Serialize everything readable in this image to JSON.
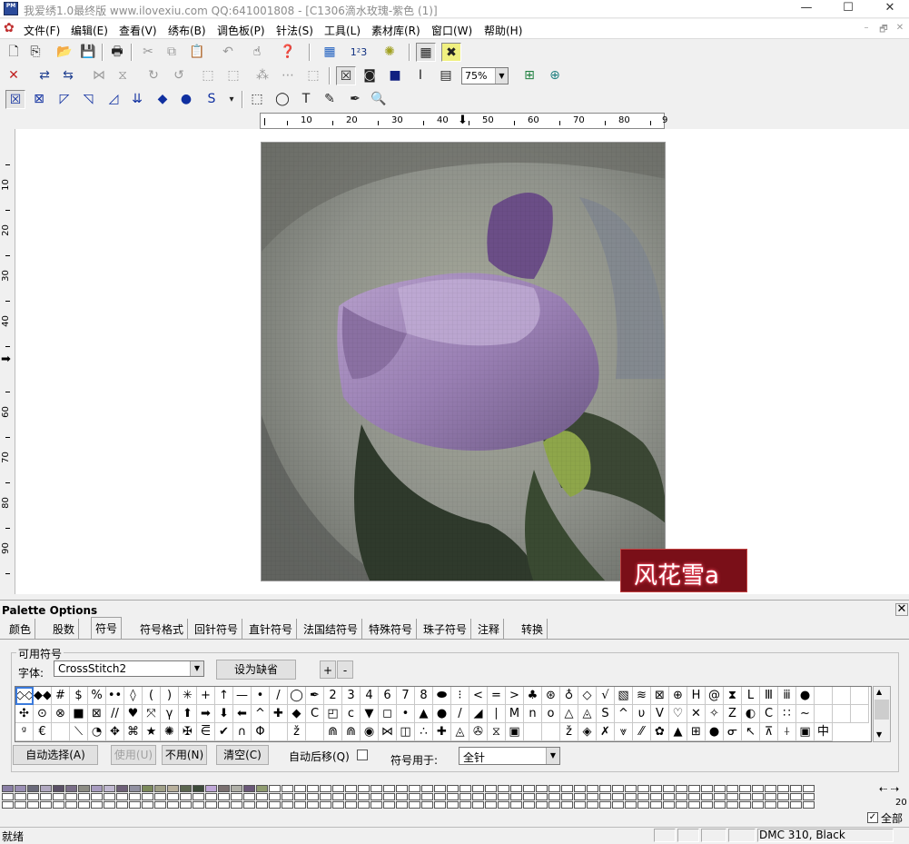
{
  "window": {
    "title": "我爱绣1.0最终版 www.ilovexiu.com QQ:641001808 - [C1306滴水玫瑰-紫色 (1)]",
    "app_icon_text": "PM",
    "minimize": "—",
    "maximize": "☐",
    "close": "✕"
  },
  "menu": {
    "items": [
      "文件(F)",
      "编辑(E)",
      "查看(V)",
      "绣布(B)",
      "调色板(P)",
      "针法(S)",
      "工具(L)",
      "素材库(R)",
      "窗口(W)",
      "帮助(H)"
    ],
    "mdi": [
      "–",
      "🗗",
      "✕"
    ]
  },
  "toolbar1": {
    "icons": [
      "new-icon",
      "copy-file-icon",
      "open-icon",
      "save-icon",
      "print-icon",
      "cut-icon",
      "copy-icon",
      "paste-icon",
      "undo-icon",
      "pointer-icon",
      "help-icon",
      "palette-icon",
      "number-icon",
      "sun-icon",
      "grid-icon",
      "cross-tool-icon"
    ],
    "glyphs": [
      "🗋",
      "⎘",
      "📂",
      "💾",
      "🖶",
      "✂",
      "⧉",
      "📋",
      "↶",
      "☝",
      "❓",
      "▦",
      "1²3",
      "✺",
      "▦",
      "✖"
    ]
  },
  "toolbar2": {
    "glyphs": [
      "✕",
      "⇄",
      "⇆",
      "⋈",
      "⧖",
      "↻",
      "↺",
      "⬚",
      "⬚",
      "⁂",
      "⋯",
      "⬚",
      "☒",
      "◙",
      "■",
      "I",
      "▤",
      "⊞",
      "⊕"
    ],
    "zoom": "75%"
  },
  "toolbar3": {
    "glyphs": [
      "☒",
      "⊠",
      "◸",
      "◹",
      "◿",
      "⇊",
      "◆",
      "●",
      "S",
      "▾",
      "⬚",
      "◯",
      "T",
      "✎",
      "✒",
      "🔍"
    ]
  },
  "ruler": {
    "h_labels": [
      "10",
      "20",
      "30",
      "40",
      "50",
      "60",
      "70",
      "80",
      "9"
    ],
    "v_labels": [
      "10",
      "20",
      "30",
      "40",
      "50",
      "60",
      "70",
      "80",
      "90"
    ]
  },
  "watermark": {
    "text": "风花雪a"
  },
  "palette": {
    "title": "Palette Options",
    "close": "✕",
    "tabs": [
      "颜色",
      "股数",
      "符号",
      "符号格式",
      "回针符号",
      "直针符号",
      "法国结符号",
      "特殊符号",
      "珠子符号",
      "注释",
      "转换"
    ],
    "active_tab": "符号",
    "group_label": "可用符号",
    "font_label": "字体:",
    "font_value": "CrossStitch2",
    "set_default": "设为缺省",
    "plus": "+",
    "minus": "-",
    "symbols": [
      "◇◇",
      "◆◆",
      "#",
      "$",
      "%",
      "••",
      "◊",
      "(",
      ")",
      "✳",
      "+",
      "↑",
      "—",
      "•",
      "/",
      "◯",
      "✒",
      "2",
      "3",
      "4",
      "6",
      "7",
      "8",
      "⬬",
      "⁝",
      "<",
      "=",
      ">",
      "♣",
      "⊛",
      "♁",
      "◇",
      "√",
      "▧",
      "≋",
      "⊠",
      "⊕",
      "H",
      "@",
      "⧗",
      "L",
      "Ⅲ",
      "ⅲ",
      "●",
      "",
      "",
      "",
      "✣",
      "⊙",
      "⊗",
      "■",
      "⊠",
      "//",
      "♥",
      "⤧",
      "γ",
      "⬆",
      "➡",
      "⬇",
      "⬅",
      "^",
      "✚",
      "◆",
      "C",
      "◰",
      "c",
      "▼",
      "◻",
      "•",
      "▲",
      "●",
      "/",
      "◢",
      "∣",
      "M",
      "n",
      "o",
      "△",
      "◬",
      "Ѕ",
      "^",
      "υ",
      "V",
      "♡",
      "✕",
      "✧",
      "Z",
      "◐",
      "C",
      "∷",
      "~",
      "",
      "",
      "",
      "ᵍ",
      "€",
      "",
      "⟍",
      "◔",
      "✥",
      "⌘",
      "★",
      "✺",
      "✠",
      "⋶",
      "✔",
      "∩",
      "Φ",
      "",
      "ž",
      "",
      "⋒",
      "⋒",
      "◉",
      "⋈",
      "◫",
      "∴",
      "✚",
      "◬",
      "✇",
      "⧖",
      "▣",
      "",
      "",
      "ž",
      "◈",
      "✗",
      "⩔",
      "⁄⁄",
      "✿",
      "▲",
      "⊞",
      "●",
      "ᓂ",
      "↖",
      "⊼",
      "⍭",
      "▣",
      "中"
    ],
    "auto_select": "自动选择(A)",
    "use": "使用(U)",
    "unuse": "不用(N)",
    "clear": "清空(C)",
    "auto_move": "自动后移(Q)",
    "apply_label": "符号用于:",
    "apply_value": "全针",
    "swatch_count": "20",
    "swatch_nav": "⇠ ⇢",
    "all_label": "全部"
  },
  "swatch_colors": [
    "#8a7fa6",
    "#9a8fb4",
    "#6a6a7a",
    "#b0a8c0",
    "#5a5066",
    "#7a6e88",
    "#8c8c84",
    "#a89cc0",
    "#c0b8d0",
    "#6e6078",
    "#9090a0",
    "#7c8a5c",
    "#a0a088",
    "#b8b09c",
    "#5c6650",
    "#3c4a3a",
    "#c0a8d8",
    "#7a7070",
    "#b0b0a8",
    "#6a5878",
    "#909c70"
  ],
  "status": {
    "ready": "就绪",
    "color": "DMC  310, Black"
  }
}
